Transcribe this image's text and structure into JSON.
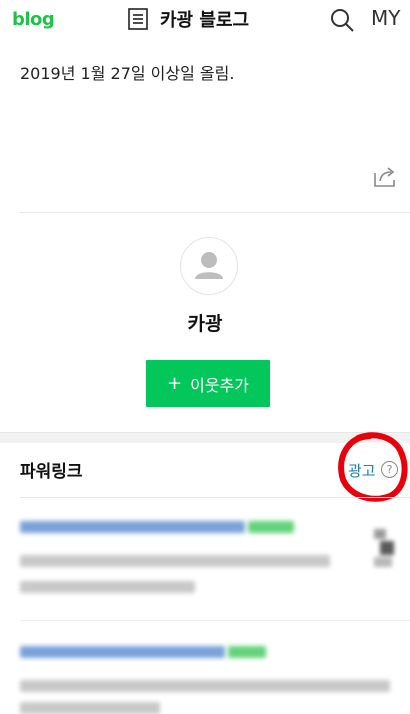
{
  "header": {
    "logo": "blog",
    "title": "카광 블로그",
    "my_label": "MY"
  },
  "post": {
    "text": "2019년 1월 27일 이상일 올림."
  },
  "profile": {
    "nickname": "카광",
    "add_button_label": "이웃추가"
  },
  "powerlink": {
    "title": "파워링크",
    "ad_label": "광고",
    "info_glyph": "?"
  },
  "colors": {
    "brand_green": "#03c75a",
    "logo_green": "#1fc34a",
    "ad_label_blue": "#1c7bb9",
    "annotation_red": "#e8000b"
  },
  "icons": [
    "list-icon",
    "search-icon",
    "share-icon",
    "default-avatar-icon",
    "info-icon"
  ]
}
